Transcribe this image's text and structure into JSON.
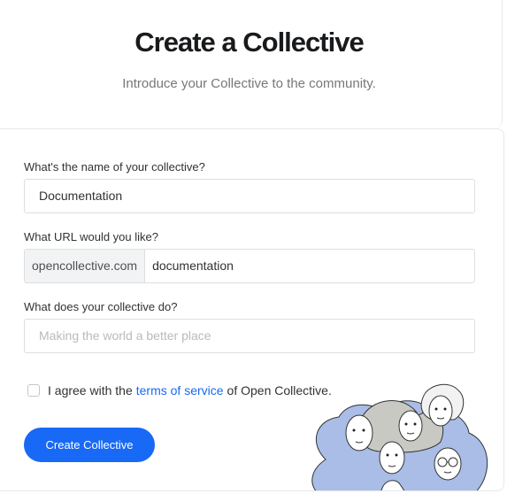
{
  "header": {
    "title": "Create a Collective",
    "subtitle": "Introduce your Collective to the community."
  },
  "form": {
    "name_label": "What's the name of your collective?",
    "name_value": "Documentation",
    "url_label": "What URL would you like?",
    "url_prefix": "opencollective.com",
    "url_value": "documentation",
    "description_label": "What does your collective do?",
    "description_placeholder": "Making the world a better place",
    "agree_prefix": "I agree with the",
    "agree_link": "terms of service",
    "agree_suffix": "of Open Collective.",
    "agree_checked": false,
    "submit_label": "Create Collective"
  },
  "colors": {
    "accent": "#1869f5",
    "border": "#dcdee0",
    "prefix_bg": "#f2f3f5"
  },
  "illustration": {
    "icon": "community-people-illustration"
  }
}
